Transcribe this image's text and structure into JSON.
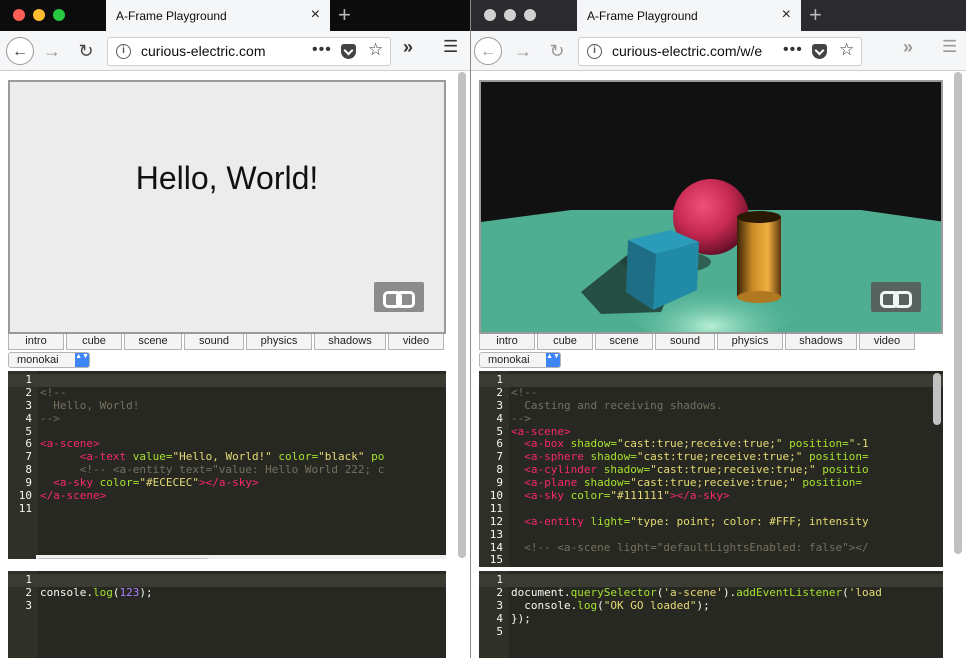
{
  "left_window": {
    "tab_title": "A-Frame Playground",
    "url": "curious-electric.com",
    "demo_tabs": [
      "intro",
      "cube",
      "scene",
      "sound",
      "physics",
      "shadows",
      "video"
    ],
    "theme": "monokai",
    "scene_text": "Hello, World!",
    "html_lines": [
      {
        "n": "1",
        "parts": []
      },
      {
        "n": "2",
        "parts": [
          {
            "c": "c",
            "t": "<!--"
          }
        ]
      },
      {
        "n": "3",
        "parts": [
          {
            "c": "c",
            "t": "  Hello, World!"
          }
        ]
      },
      {
        "n": "4",
        "parts": [
          {
            "c": "c",
            "t": "-->"
          }
        ]
      },
      {
        "n": "5",
        "parts": []
      },
      {
        "n": "6",
        "parts": [
          {
            "c": "t",
            "t": "<a-scene>"
          }
        ]
      },
      {
        "n": "7",
        "parts": [
          {
            "c": "t",
            "t": "      <a-text "
          },
          {
            "c": "a",
            "t": "value="
          },
          {
            "c": "s",
            "t": "\"Hello, World!\""
          },
          {
            "c": "a",
            "t": " color="
          },
          {
            "c": "s",
            "t": "\"black\""
          },
          {
            "c": "a",
            "t": " po"
          }
        ]
      },
      {
        "n": "8",
        "parts": [
          {
            "c": "c",
            "t": "      <!-- <a-entity text=\"value: Hello World 222; c"
          }
        ]
      },
      {
        "n": "9",
        "parts": [
          {
            "c": "t",
            "t": "  <a-sky "
          },
          {
            "c": "a",
            "t": "color="
          },
          {
            "c": "s",
            "t": "\"#ECECEC\""
          },
          {
            "c": "t",
            "t": "></a-sky>"
          }
        ]
      },
      {
        "n": "10",
        "parts": [
          {
            "c": "t",
            "t": "</a-scene>"
          }
        ]
      },
      {
        "n": "11",
        "parts": []
      }
    ],
    "js_lines": [
      {
        "n": "1",
        "parts": []
      },
      {
        "n": "2",
        "parts": [
          {
            "c": "",
            "t": "console."
          },
          {
            "c": "a",
            "t": "log"
          },
          {
            "c": "",
            "t": "("
          },
          {
            "c": "n",
            "t": "123"
          },
          {
            "c": "",
            "t": ");"
          }
        ]
      },
      {
        "n": "3",
        "parts": []
      }
    ]
  },
  "right_window": {
    "tab_title": "A-Frame Playground",
    "url": "curious-electric.com/w/e",
    "demo_tabs": [
      "intro",
      "cube",
      "scene",
      "sound",
      "physics",
      "shadows",
      "video"
    ],
    "theme": "monokai",
    "html_lines": [
      {
        "n": "1",
        "parts": []
      },
      {
        "n": "2",
        "parts": [
          {
            "c": "c",
            "t": "<!--"
          }
        ]
      },
      {
        "n": "3",
        "parts": [
          {
            "c": "c",
            "t": "  Casting and receiving shadows."
          }
        ]
      },
      {
        "n": "4",
        "parts": [
          {
            "c": "c",
            "t": "-->"
          }
        ]
      },
      {
        "n": "5",
        "parts": [
          {
            "c": "t",
            "t": "<a-scene>"
          }
        ]
      },
      {
        "n": "6",
        "parts": [
          {
            "c": "t",
            "t": "  <a-box "
          },
          {
            "c": "a",
            "t": "shadow="
          },
          {
            "c": "s",
            "t": "\"cast:true;receive:true;\""
          },
          {
            "c": "a",
            "t": " position="
          },
          {
            "c": "s",
            "t": "\"-1"
          }
        ]
      },
      {
        "n": "7",
        "parts": [
          {
            "c": "t",
            "t": "  <a-sphere "
          },
          {
            "c": "a",
            "t": "shadow="
          },
          {
            "c": "s",
            "t": "\"cast:true;receive:true;\""
          },
          {
            "c": "a",
            "t": " position="
          }
        ]
      },
      {
        "n": "8",
        "parts": [
          {
            "c": "t",
            "t": "  <a-cylinder "
          },
          {
            "c": "a",
            "t": "shadow="
          },
          {
            "c": "s",
            "t": "\"cast:true;receive:true;\""
          },
          {
            "c": "a",
            "t": " positio"
          }
        ]
      },
      {
        "n": "9",
        "parts": [
          {
            "c": "t",
            "t": "  <a-plane "
          },
          {
            "c": "a",
            "t": "shadow="
          },
          {
            "c": "s",
            "t": "\"cast:true;receive:true;\""
          },
          {
            "c": "a",
            "t": " position="
          }
        ]
      },
      {
        "n": "10",
        "parts": [
          {
            "c": "t",
            "t": "  <a-sky "
          },
          {
            "c": "a",
            "t": "color="
          },
          {
            "c": "s",
            "t": "\"#111111\""
          },
          {
            "c": "t",
            "t": "></a-sky>"
          }
        ]
      },
      {
        "n": "11",
        "parts": []
      },
      {
        "n": "12",
        "parts": [
          {
            "c": "t",
            "t": "  <a-entity "
          },
          {
            "c": "a",
            "t": "light="
          },
          {
            "c": "s",
            "t": "\"type: point; color: #FFF; intensity"
          }
        ]
      },
      {
        "n": "13",
        "parts": []
      },
      {
        "n": "14",
        "parts": [
          {
            "c": "c",
            "t": "  <!-- <a-scene light=\"defaultLightsEnabled: false\"></"
          }
        ]
      },
      {
        "n": "15",
        "parts": []
      }
    ],
    "js_lines": [
      {
        "n": "1",
        "parts": []
      },
      {
        "n": "2",
        "parts": [
          {
            "c": "",
            "t": "document."
          },
          {
            "c": "a",
            "t": "querySelector"
          },
          {
            "c": "",
            "t": "("
          },
          {
            "c": "s",
            "t": "'a-scene'"
          },
          {
            "c": "",
            "t": ")."
          },
          {
            "c": "a",
            "t": "addEventListener"
          },
          {
            "c": "",
            "t": "("
          },
          {
            "c": "s",
            "t": "'load"
          }
        ]
      },
      {
        "n": "3",
        "parts": [
          {
            "c": "",
            "t": "  console."
          },
          {
            "c": "a",
            "t": "log"
          },
          {
            "c": "",
            "t": "("
          },
          {
            "c": "s",
            "t": "\"OK GO loaded\""
          },
          {
            "c": "",
            "t": ");"
          }
        ]
      },
      {
        "n": "4",
        "parts": [
          {
            "c": "",
            "t": "});"
          }
        ]
      },
      {
        "n": "5",
        "parts": []
      }
    ]
  },
  "icons": {
    "close": "×",
    "new_tab": "+",
    "back": "←",
    "forward": "→",
    "reload": "↻",
    "info": "i",
    "more": "•••",
    "star": "☆",
    "overflow": "»",
    "menu": "☰",
    "select_arrows": "▲▼"
  },
  "colors": {
    "traffic_red": "#fe5f57",
    "traffic_yellow": "#febc2e",
    "traffic_green": "#28c840",
    "inactive_dot": "#d0d0d0",
    "editor_bg": "#272822",
    "keyword": "#f92672",
    "attr": "#a6e22e",
    "string": "#e6db74",
    "comment": "#75715e"
  }
}
